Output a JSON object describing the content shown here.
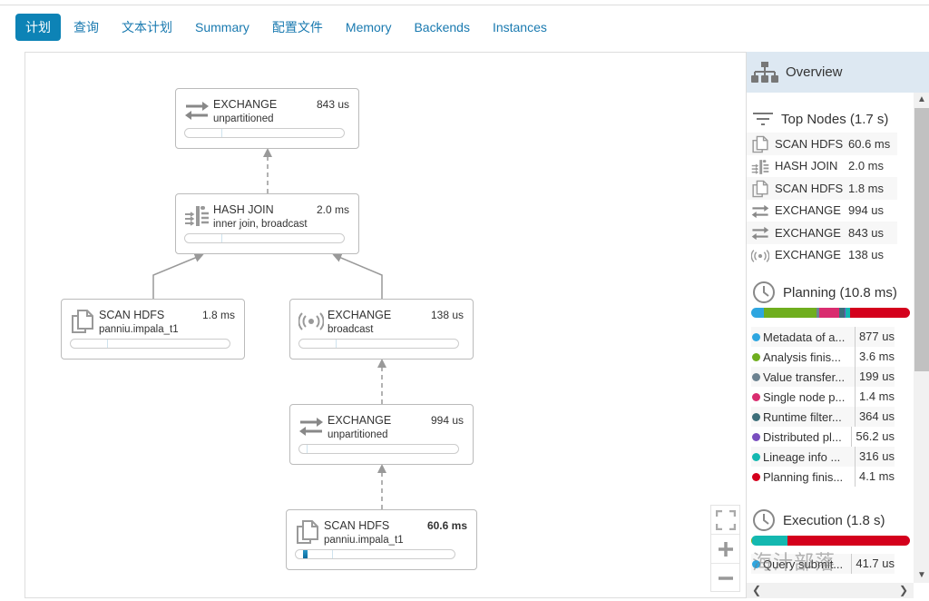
{
  "tabs": [
    {
      "label": "计划",
      "active": true
    },
    {
      "label": "查询"
    },
    {
      "label": "文本计划"
    },
    {
      "label": "Summary"
    },
    {
      "label": "配置文件"
    },
    {
      "label": "Memory"
    },
    {
      "label": "Backends"
    },
    {
      "label": "Instances"
    }
  ],
  "plan": {
    "nodes": [
      {
        "id": "exchange-unpartitioned-top",
        "icon": "exchange-icon",
        "name": "EXCHANGE",
        "detail": "unpartitioned",
        "time": "843 us",
        "bold": false,
        "progress_pct": 0
      },
      {
        "id": "hash-join",
        "icon": "hash-join-icon",
        "name": "HASH JOIN",
        "detail": "inner join, broadcast",
        "time": "2.0 ms",
        "bold": false,
        "progress_pct": 0
      },
      {
        "id": "scan-hdfs-left",
        "icon": "scan-hdfs-icon",
        "name": "SCAN HDFS",
        "detail": "panniu.impala_t1",
        "time": "1.8 ms",
        "bold": false,
        "progress_pct": 0
      },
      {
        "id": "exchange-broadcast",
        "icon": "broadcast-icon",
        "name": "EXCHANGE",
        "detail": "broadcast",
        "time": "138 us",
        "bold": false,
        "progress_pct": 0
      },
      {
        "id": "exchange-unpartitioned-mid",
        "icon": "exchange-icon",
        "name": "EXCHANGE",
        "detail": "unpartitioned",
        "time": "994 us",
        "bold": false,
        "progress_pct": 0
      },
      {
        "id": "scan-hdfs-bottom",
        "icon": "scan-hdfs-icon",
        "name": "SCAN HDFS",
        "detail": "panniu.impala_t1",
        "time": "60.6 ms",
        "bold": true,
        "progress_pct": 3.5
      }
    ]
  },
  "sidebar": {
    "title": "Overview",
    "top_nodes": {
      "title": "Top Nodes (1.7 s)",
      "items": [
        {
          "icon": "scan-hdfs-icon",
          "name": "SCAN HDFS",
          "time": "60.6 ms"
        },
        {
          "icon": "hash-join-icon",
          "name": "HASH JOIN",
          "time": "2.0 ms"
        },
        {
          "icon": "scan-hdfs-icon",
          "name": "SCAN HDFS",
          "time": "1.8 ms"
        },
        {
          "icon": "exchange-icon",
          "name": "EXCHANGE",
          "time": "994 us"
        },
        {
          "icon": "exchange-icon",
          "name": "EXCHANGE",
          "time": "843 us"
        },
        {
          "icon": "broadcast-icon",
          "name": "EXCHANGE",
          "time": "138 us"
        }
      ]
    },
    "planning": {
      "title": "Planning (10.8 ms)",
      "events": [
        {
          "label": "Metadata of a...",
          "time": "877 us",
          "color": "#2ea6e0",
          "share": 8.1
        },
        {
          "label": "Analysis finis...",
          "time": "3.6 ms",
          "color": "#6fae1e",
          "share": 33.3
        },
        {
          "label": "Value transfer...",
          "time": "199 us",
          "color": "#6c8290",
          "share": 1.8
        },
        {
          "label": "Single node p...",
          "time": "1.4 ms",
          "color": "#d92d6f",
          "share": 13.0
        },
        {
          "label": "Runtime filter...",
          "time": "364 us",
          "color": "#3d6f7a",
          "share": 3.4
        },
        {
          "label": "Distributed pl...",
          "time": "56.2 us",
          "color": "#7a4fbf",
          "share": 0.5
        },
        {
          "label": "Lineage info ...",
          "time": "316 us",
          "color": "#14b8b0",
          "share": 2.9
        },
        {
          "label": "Planning finis...",
          "time": "4.1 ms",
          "color": "#d4001c",
          "share": 37.9
        }
      ]
    },
    "execution": {
      "title": "Execution (1.8 s)",
      "segments": [
        {
          "color": "#6fae1e",
          "share": 0.5
        },
        {
          "color": "#14b8b0",
          "share": 22.5
        },
        {
          "color": "#d4001c",
          "share": 77
        }
      ],
      "events": [
        {
          "label": "Query submit...",
          "time": "41.7 us",
          "color": "#2ea6e0"
        }
      ]
    }
  },
  "watermark": "海汁部落"
}
